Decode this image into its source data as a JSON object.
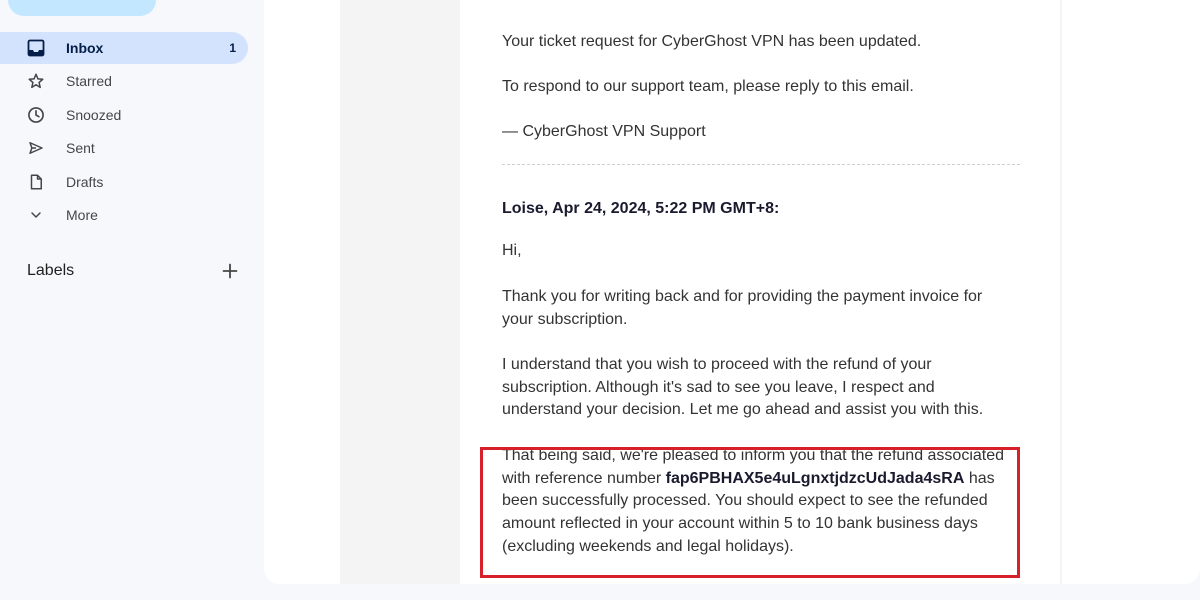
{
  "sidebar": {
    "items": [
      {
        "label": "Inbox",
        "icon": "inbox-icon",
        "count": "1",
        "active": true
      },
      {
        "label": "Starred",
        "icon": "star-icon"
      },
      {
        "label": "Snoozed",
        "icon": "clock-icon"
      },
      {
        "label": "Sent",
        "icon": "send-icon"
      },
      {
        "label": "Drafts",
        "icon": "draft-icon"
      },
      {
        "label": "More",
        "icon": "chevron-down-icon"
      }
    ],
    "labels_title": "Labels"
  },
  "email": {
    "para_updated": "Your ticket request for CyberGhost VPN has been updated.",
    "para_respond": "To respond to our support team, please reply to this email.",
    "signature": "— CyberGhost VPN Support",
    "sender_line": "Loise, Apr 24, 2024, 5:22 PM GMT+8:",
    "greeting": "Hi,",
    "para_thanks": "Thank you for writing back and for providing the payment invoice for your subscription.",
    "para_understand": "I understand that you wish to proceed with the refund of your subscription. Although it's sad to see you leave, I respect and understand your decision. Let me go ahead and assist you with this.",
    "refund_intro": "That being said, we're pleased to inform you that the refund associated with reference number",
    "reference_number": "fap6PBHAX5e4uLgnxtjdzcUdJada4sRA",
    "refund_rest": "has been successfully processed. You should expect to see the refunded amount reflected in your account within 5 to 10 bank business days (excluding weekends and legal holidays)."
  },
  "colors": {
    "active_nav_bg": "#d3e3fd",
    "compose_bg": "#c2e7ff",
    "highlight_border": "#d7202a"
  }
}
